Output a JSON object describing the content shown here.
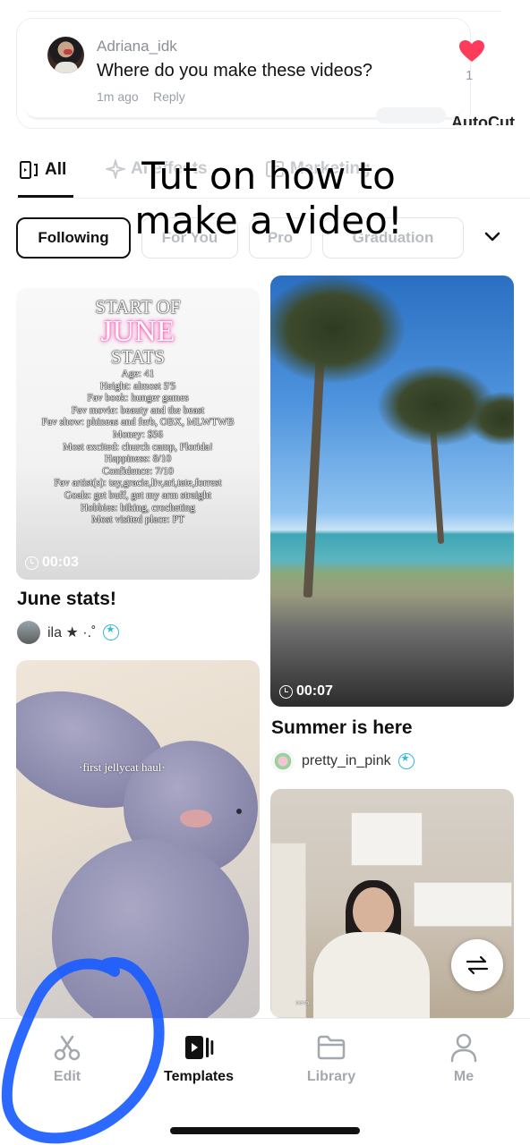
{
  "comment": {
    "username": "Adriana_idk",
    "text": "Where do you make these videos?",
    "time": "1m ago",
    "reply_label": "Reply",
    "like_count": "1"
  },
  "partial_label": "AutoCut",
  "category_tabs": [
    {
      "label": "All",
      "icon": "all-icon",
      "active": true
    },
    {
      "label": "AI effects",
      "icon": "sparkle-icon",
      "active": false
    },
    {
      "label": "Marketing",
      "icon": "marketing-icon",
      "active": false
    }
  ],
  "overlay_text": {
    "line1": "Tut on how to",
    "line2": "make a video!"
  },
  "filters": [
    {
      "label": "Following",
      "active": true
    },
    {
      "label": "For You",
      "active": false
    },
    {
      "label": "Pro",
      "active": false
    },
    {
      "label": "Graduation",
      "active": false
    }
  ],
  "cards": [
    {
      "title": "June stats!",
      "duration": "00:03",
      "author": "ila ★ ·.˚",
      "overlay_title": [
        "START OF",
        "JUNE",
        "STATS"
      ],
      "overlay_lines": [
        "Age: 41",
        "Height: almost 5'5",
        "Fav book: hunger games",
        "Fav movie: beauty and the beast",
        "Fav show: phineas and ferb, OBX, MLWTWB",
        "Money: $56",
        "Most excited: church camp, Florida!",
        "Happiness: 8/10",
        "Confidence: 7/10",
        "Fav artist(s): tay,gracie,liv,ari,tate,forrest",
        "Goals: get buff, get my arm straight",
        "Hobbies: biking, crocheting",
        "Most visited place: PT"
      ]
    },
    {
      "title": "Summer is here",
      "duration": "00:07",
      "author": "pretty_in_pink"
    },
    {
      "title": "",
      "overlay_caption": "·first jellycat haul·"
    },
    {
      "title": "",
      "caption_small": "neva"
    }
  ],
  "bottom_nav": [
    {
      "label": "Edit",
      "icon": "scissors-icon",
      "active": false
    },
    {
      "label": "Templates",
      "icon": "templates-icon",
      "active": true
    },
    {
      "label": "Library",
      "icon": "folder-icon",
      "active": false
    },
    {
      "label": "Me",
      "icon": "person-icon",
      "active": false
    }
  ],
  "colors": {
    "heart": "#ff3b5c",
    "verified": "#33b8d6",
    "marker": "#1a5cff",
    "june_glow": "#ff4fb8"
  }
}
